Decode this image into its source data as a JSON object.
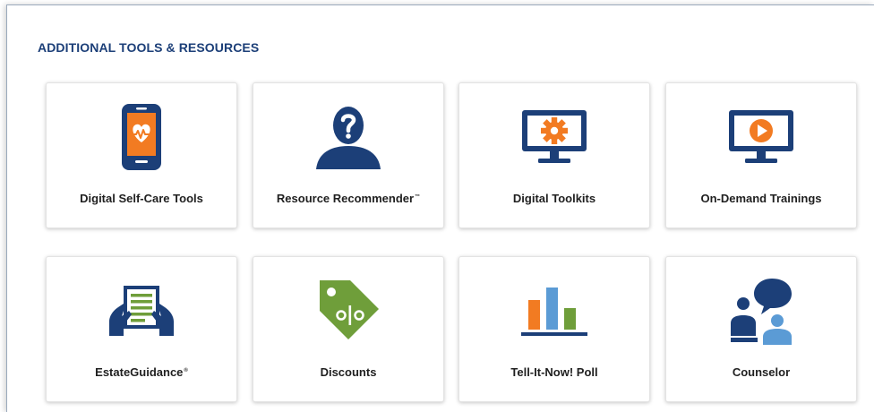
{
  "section": {
    "title": "ADDITIONAL TOOLS & RESOURCES"
  },
  "colors": {
    "navy": "#1c3f78",
    "orange": "#f27b22",
    "green": "#6f9e3a",
    "light_blue": "#5b9bd5"
  },
  "cards": [
    {
      "label": "Digital Self-Care Tools",
      "icon": "phone-heart-icon"
    },
    {
      "label": "Resource Recommender",
      "mark": "™",
      "icon": "person-question-icon"
    },
    {
      "label": "Digital Toolkits",
      "icon": "monitor-gear-icon"
    },
    {
      "label": "On-Demand Trainings",
      "icon": "monitor-play-icon"
    },
    {
      "label": "EstateGuidance",
      "mark": "®",
      "icon": "hands-document-icon"
    },
    {
      "label": "Discounts",
      "icon": "percent-tag-icon"
    },
    {
      "label": "Tell-It-Now! Poll",
      "icon": "bar-chart-icon"
    },
    {
      "label": "Counselor",
      "icon": "counselor-chat-icon"
    }
  ]
}
